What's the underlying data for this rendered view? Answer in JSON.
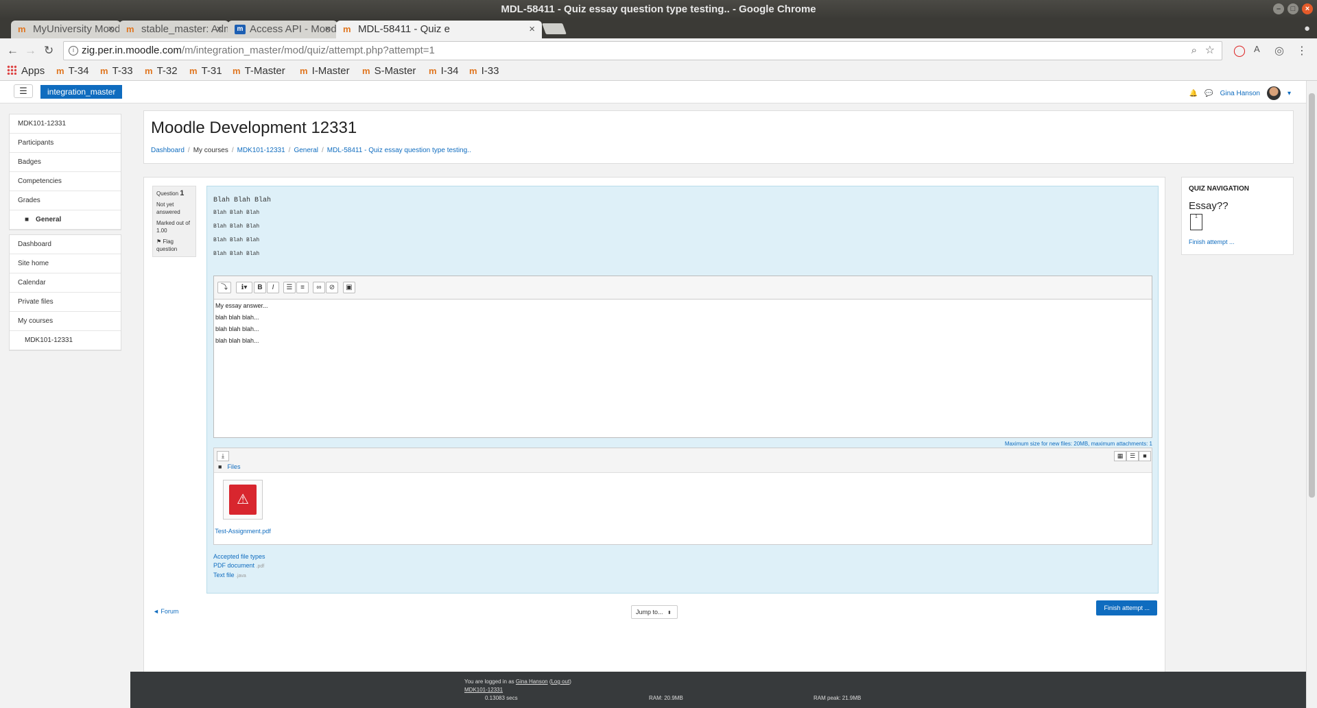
{
  "window": {
    "title": "MDL-58411 - Quiz essay question type testing.. - Google Chrome"
  },
  "tabs": [
    {
      "label": "MyUniversity Mood",
      "favicon": "moodle-icon"
    },
    {
      "label": "stable_master: Adm",
      "favicon": "moodle-icon"
    },
    {
      "label": "Access API - Moodle",
      "favicon": "moodle-docs-icon"
    },
    {
      "label": "MDL-58411 - Quiz e",
      "favicon": "moodle-icon",
      "active": true
    }
  ],
  "address": {
    "host": "zig.per.in.moodle.com",
    "path": "/m/integration_master/mod/quiz/attempt.php?attempt=1"
  },
  "bookmarks": {
    "apps": "Apps",
    "items": [
      "T-34",
      "T-33",
      "T-32",
      "T-31",
      "T-Master",
      "I-Master",
      "S-Master",
      "I-34",
      "I-33"
    ]
  },
  "navbar": {
    "brand": "integration_master",
    "user": "Gina Hanson"
  },
  "left_nav": {
    "course": [
      "MDK101-12331",
      "Participants",
      "Badges",
      "Competencies",
      "Grades",
      "General"
    ],
    "site": [
      "Dashboard",
      "Site home",
      "Calendar",
      "Private files",
      "My courses",
      "MDK101-12331"
    ]
  },
  "header": {
    "title": "Moodle Development 12331",
    "breadcrumbs": [
      "Dashboard",
      "My courses",
      "MDK101-12331",
      "General",
      "MDL-58411 - Quiz essay question type testing.."
    ]
  },
  "question": {
    "label": "Question",
    "number": "1",
    "status": "Not yet answered",
    "marked": "Marked out of 1.00",
    "flag": "Flag question",
    "text_lines": [
      "Blah Blah Blah",
      "Blah Blah Blah",
      "Blah Blah Blah",
      "Blah Blah Blah",
      "Blah Blah Blah"
    ]
  },
  "editor": {
    "content": [
      "My essay answer...",
      "blah blah blah...",
      "blah blah blah...",
      "blah blah blah..."
    ]
  },
  "files": {
    "max_size": "Maximum size for new files: 20MB, maximum attachments: 1",
    "folder": "Files",
    "file_name": "Test-Assignment.pdf",
    "accepted_label": "Accepted file types",
    "types": [
      {
        "name": "PDF document",
        "ext": ".pdf"
      },
      {
        "name": "Text file",
        "ext": ".java"
      }
    ]
  },
  "nav": {
    "prev": "◄ Forum",
    "jump": "Jump to...",
    "finish": "Finish attempt ..."
  },
  "quiz_nav": {
    "heading": "QUIZ NAVIGATION",
    "title": "Essay??",
    "q1": "1",
    "finish": "Finish attempt ..."
  },
  "footer": {
    "logged_in": "You are logged in as",
    "user": "Gina Hanson",
    "logout": "Log out",
    "course": "MDK101-12331",
    "secs": "0.13083 secs",
    "ram": "RAM: 20.9MB",
    "ram_peak": "RAM peak: 21.9MB"
  }
}
